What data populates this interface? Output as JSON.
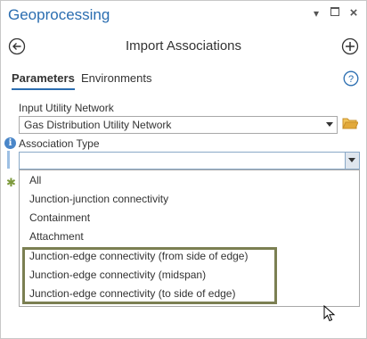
{
  "window": {
    "title": "Geoprocessing"
  },
  "tool": {
    "title": "Import Associations"
  },
  "tabs": [
    {
      "label": "Parameters"
    },
    {
      "label": "Environments"
    }
  ],
  "params": {
    "input_network_label": "Input Utility Network",
    "input_network_value": "Gas Distribution Utility Network",
    "association_type_label": "Association Type",
    "association_type_value": ""
  },
  "dropdown": {
    "options": [
      "All",
      "Junction-junction connectivity",
      "Containment",
      "Attachment",
      "Junction-edge connectivity (from side of edge)",
      "Junction-edge connectivity (midspan)",
      "Junction-edge connectivity (to side of edge)"
    ]
  },
  "icons": {
    "pin": "pin-icon",
    "maximize": "maximize-icon",
    "close": "close-icon",
    "back": "back-arrow-icon",
    "add": "add-icon",
    "help": "help-icon",
    "folder": "folder-icon",
    "info": "info-icon",
    "required": "required-asterisk-icon",
    "cursor": "mouse-cursor-icon"
  },
  "colors": {
    "accent": "#2a6db0",
    "highlight_border": "#7b7f52",
    "required": "#7d9a3c",
    "folder": "#e2a93a"
  }
}
